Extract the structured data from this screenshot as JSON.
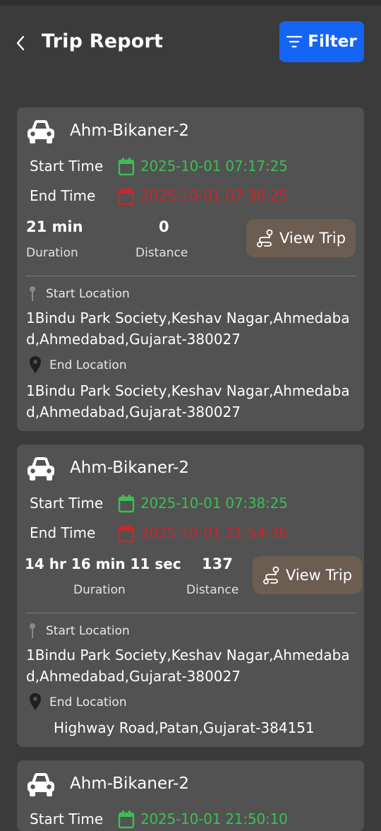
{
  "header": {
    "title": "Trip Report",
    "filter_label": "Filter",
    "accent_color": "#1565f5"
  },
  "labels": {
    "start_time": "Start Time",
    "end_time": "End Time",
    "duration": "Duration",
    "distance": "Distance",
    "view_trip": "View Trip",
    "start_location": "Start Location",
    "end_location": "End Location"
  },
  "trips": [
    {
      "vehicle": "Ahm-Bikaner-2",
      "start_time": "2025-10-01 07:17:25",
      "end_time": "2025-10-01 07:38:25",
      "duration": "21 min",
      "distance": "0",
      "start_location": "1Bindu Park Society,Keshav Nagar,Ahmedabad,Ahmedabad,Gujarat-380027",
      "end_location": "1Bindu Park Society,Keshav Nagar,Ahmedabad,Ahmedabad,Gujarat-380027"
    },
    {
      "vehicle": "Ahm-Bikaner-2",
      "start_time": "2025-10-01 07:38:25",
      "end_time": "2025-10-01 21:54:36",
      "duration": "14 hr 16 min 11 sec",
      "distance": "137",
      "start_location": "1Bindu Park Society,Keshav Nagar,Ahmedabad,Ahmedabad,Gujarat-380027",
      "end_location": "Highway Road,Patan,Gujarat-384151"
    },
    {
      "vehicle": "Ahm-Bikaner-2",
      "start_time": "2025-10-01 21:50:10"
    }
  ],
  "colors": {
    "start_time": "#3dbe54",
    "end_time": "#c6282d",
    "card_background": "#525252",
    "view_trip_button": "#6b5d50"
  },
  "icons": {
    "back": "chevron-left-icon",
    "filter": "filter-lines-icon",
    "vehicle": "car-icon",
    "calendar": "calendar-icon",
    "view_trip": "route-icon",
    "start_location": "pin-icon",
    "end_location": "map-marker-icon"
  }
}
